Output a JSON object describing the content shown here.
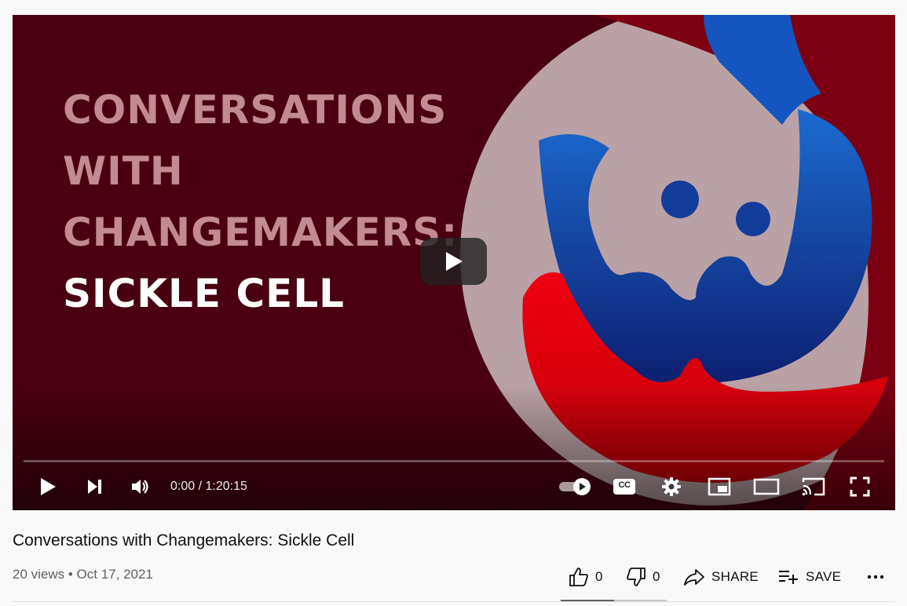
{
  "video": {
    "thumbnail_lines": [
      "CONVERSATIONS",
      "WITH",
      "CHANGEMAKERS:",
      "SICKLE CELL"
    ],
    "time_display": "0:00 / 1:20:15",
    "progress_fraction": 0
  },
  "controls": {
    "icons": [
      "play-icon",
      "next-icon",
      "volume-icon",
      "autoplay-toggle",
      "captions-icon",
      "settings-icon",
      "miniplayer-icon",
      "theater-icon",
      "cast-icon",
      "fullscreen-icon"
    ],
    "captions_label": "CC"
  },
  "info": {
    "title": "Conversations with Changemakers: Sickle Cell",
    "meta": "20 views • Oct 17, 2021"
  },
  "actions": {
    "like_count": "0",
    "dislike_count": "0",
    "share_label": "SHARE",
    "save_label": "SAVE",
    "like_fraction": 0.5
  },
  "colors": {
    "thumb_background": "#4a0010",
    "logo_ring": "#b9a1a5",
    "logo_red": "#e0000e",
    "logo_blue": "#123c9a",
    "progress": "#ff0000"
  }
}
